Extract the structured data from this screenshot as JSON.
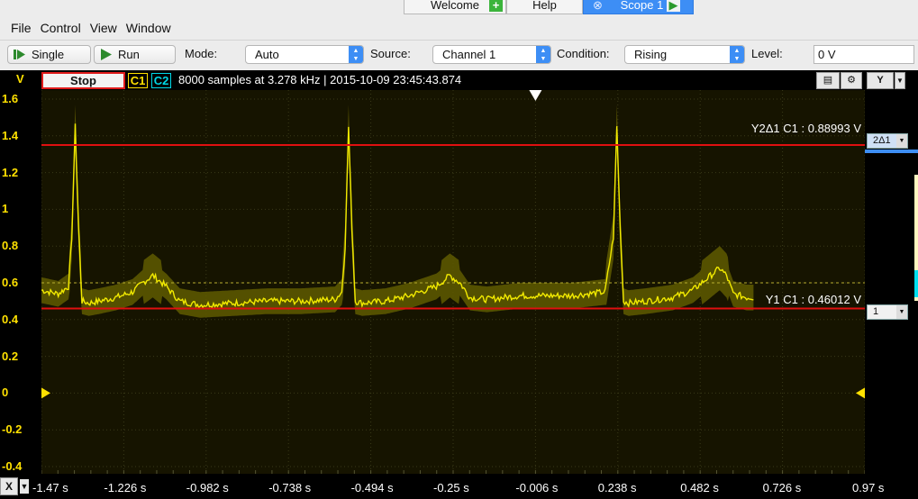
{
  "tabs": [
    {
      "label": "Welcome",
      "icon": "plus-icon"
    },
    {
      "label": "Help",
      "icon": ""
    },
    {
      "label": "Scope 1",
      "icon": "play-icon",
      "active": true
    }
  ],
  "menu": [
    "File",
    "Control",
    "View",
    "Window"
  ],
  "toolbar": {
    "single_label": "Single",
    "run_label": "Run",
    "mode_label": "Mode:",
    "mode_value": "Auto",
    "source_label": "Source:",
    "source_value": "Channel 1",
    "condition_label": "Condition:",
    "condition_value": "Rising",
    "level_label": "Level:",
    "level_value": "0 V"
  },
  "scope": {
    "y_unit": "V",
    "stop_label": "Stop",
    "ch1_label": "C1",
    "ch2_label": "C2",
    "info": "8000 samples at 3.278 kHz | 2015-10-09 23:45:43.874",
    "y_button": "Y",
    "x_button": "X",
    "cursor_y2": "Y2Δ1 C1 : 0.88993 V",
    "cursor_y1": "Y1 C1 : 0.46012 V",
    "tag_y2": "2Δ1",
    "tag_y1": "1"
  },
  "colors": {
    "trace": "#f2ea00",
    "envelope": "#5f5a00",
    "cursor": "#e01010",
    "ch1": "#ffe100",
    "ch2": "#00d8e8"
  },
  "chart_data": {
    "type": "line",
    "y_ticks": [
      "1.6",
      "1.4",
      "1.2",
      "1",
      "0.8",
      "0.6",
      "0.4",
      "0.2",
      "0",
      "-0.2",
      "-0.4"
    ],
    "x_ticks": [
      "-1.47 s",
      "-1.226 s",
      "-0.982 s",
      "-0.738 s",
      "-0.494 s",
      "-0.25 s",
      "-0.006 s",
      "0.238 s",
      "0.482 s",
      "0.726 s",
      "0.97 s"
    ],
    "xlim": [
      -1.47,
      0.97
    ],
    "ylim": [
      -0.4,
      1.6
    ],
    "cursors": [
      0.88993,
      0.46012
    ],
    "series": [
      {
        "x": [
          -1.47,
          -1.42,
          -1.39,
          -1.38,
          -1.37,
          -1.36,
          -1.35,
          -1.33,
          -1.3,
          -1.25,
          -1.2,
          -1.17,
          -1.14,
          -1.1,
          -1.06,
          -1.0,
          -0.9,
          -0.8,
          -0.7,
          -0.6,
          -0.58,
          -0.57,
          -0.56,
          -0.55,
          -0.54,
          -0.52,
          -0.45,
          -0.38,
          -0.3,
          -0.26,
          -0.23,
          -0.2,
          -0.15,
          -0.1,
          -0.05,
          0.0,
          0.1,
          0.2,
          0.225,
          0.235,
          0.245,
          0.255,
          0.27,
          0.32,
          0.4,
          0.46,
          0.5,
          0.54,
          0.56,
          0.58,
          0.62,
          0.64
        ],
        "y": [
          0.56,
          0.54,
          0.58,
          0.85,
          1.45,
          0.9,
          0.5,
          0.49,
          0.5,
          0.52,
          0.55,
          0.6,
          0.64,
          0.58,
          0.5,
          0.48,
          0.49,
          0.5,
          0.5,
          0.51,
          0.55,
          0.8,
          1.45,
          0.9,
          0.5,
          0.49,
          0.5,
          0.53,
          0.58,
          0.64,
          0.6,
          0.52,
          0.51,
          0.52,
          0.53,
          0.53,
          0.53,
          0.55,
          0.85,
          1.45,
          0.9,
          0.5,
          0.49,
          0.5,
          0.52,
          0.56,
          0.62,
          0.68,
          0.64,
          0.54,
          0.52,
          0.52
        ]
      }
    ]
  }
}
